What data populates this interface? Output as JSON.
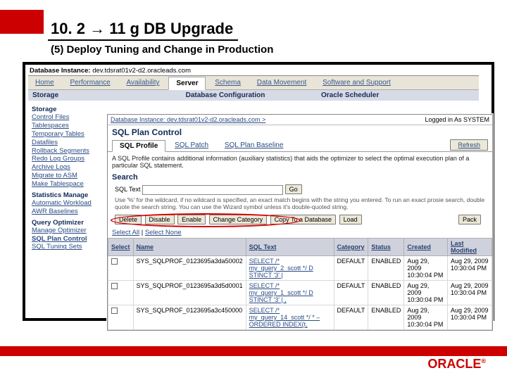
{
  "slide": {
    "title_left": "10. 2",
    "title_right": "11 g DB Upgrade",
    "subtitle": "(5) Deploy Tuning and Change in Production"
  },
  "app": {
    "instance_label": "Database Instance:",
    "instance_value": "dev.tdsrat01v2-d2.oracleads.com",
    "tabs": [
      "Home",
      "Performance",
      "Availability",
      "Server",
      "Schema",
      "Data Movement",
      "Software and Support"
    ],
    "sections": [
      "Storage",
      "Database Configuration",
      "Oracle Scheduler"
    ]
  },
  "sidebar": {
    "storage_title": "Storage",
    "storage_items": [
      "Control Files",
      "Tablespaces",
      "Temporary Tables",
      "Datafiles",
      "Rollback Segments",
      "Redo Log Groups",
      "Archive Logs",
      "Migrate to ASM",
      "Make Tablespace"
    ],
    "stats_title": "Statistics Manage",
    "stats_items": [
      "Automatic Workload",
      "AWR Baselines"
    ],
    "qo_title": "Query Optimizer",
    "qo_items": [
      "Manage Optimizer",
      "SQL Plan Control",
      "SQL Tuning Sets"
    ]
  },
  "overlay": {
    "crumb": "Database Instance: dev.tdsrat01v2-d2.oracleads.com >",
    "logged": "Logged in As SYSTEM",
    "title": "SQL Plan Control",
    "subtabs": [
      "SQL Profile",
      "SQL Patch",
      "SQL Plan Baseline"
    ],
    "desc": "A SQL Profile contains additional information (auxiliary statistics) that aids the optimizer to select the optimal execution plan of a particular SQL statement.",
    "refresh": "Refresh",
    "search_title": "Search",
    "search_label": "SQL Text",
    "search_go": "Go",
    "hint": "Use '%' for the wildcard, if no wildcard is specified, an exact match begins with the string you entered. To run an exact prosie search, double quote the search string. You can use the Wizard symbol unless it's double-quoted string.",
    "btns": [
      "Delete",
      "Disable",
      "Enable",
      "Change Category",
      "Copy To a Database",
      "Load"
    ],
    "pack": "Pack",
    "selectall": "Select All",
    "selectnone": "Select None",
    "headers": [
      "Select",
      "Name",
      "SQL Text",
      "Category",
      "Status",
      "Created",
      "Last Modified"
    ],
    "rows": [
      {
        "name": "SYS_SQLPROF_0123695a3da50002",
        "sql": "SELECT /* my_query_2_scott */\nD STINCT '3' |",
        "cat": "DEFAULT",
        "status": "ENABLED",
        "created": "Aug 29, 2009\n10:30:04 PM",
        "mod": "Aug 29, 2009\n10:30:04 PM"
      },
      {
        "name": "SYS_SQLPROF_0123695a3d5d0001",
        "sql": "SELECT /* my_query_1_scott */\nD STINCT '3' | ,",
        "cat": "DEFAULT",
        "status": "ENABLED",
        "created": "Aug 29, 2009\n10:30:04 PM",
        "mod": "Aug 29, 2009\n10:30:04 PM"
      },
      {
        "name": "SYS_SQLPROF_0123695a3c450000",
        "sql": "SELECT /* my_query_14_scott */ * –\nORDERED INDEX(t,",
        "cat": "DEFAULT",
        "status": "ENABLED",
        "created": "Aug 29, 2009\n10:30:04 PM",
        "mod": "Aug 29, 2009\n10:30:04 PM"
      }
    ]
  },
  "logo": "ORACLE"
}
